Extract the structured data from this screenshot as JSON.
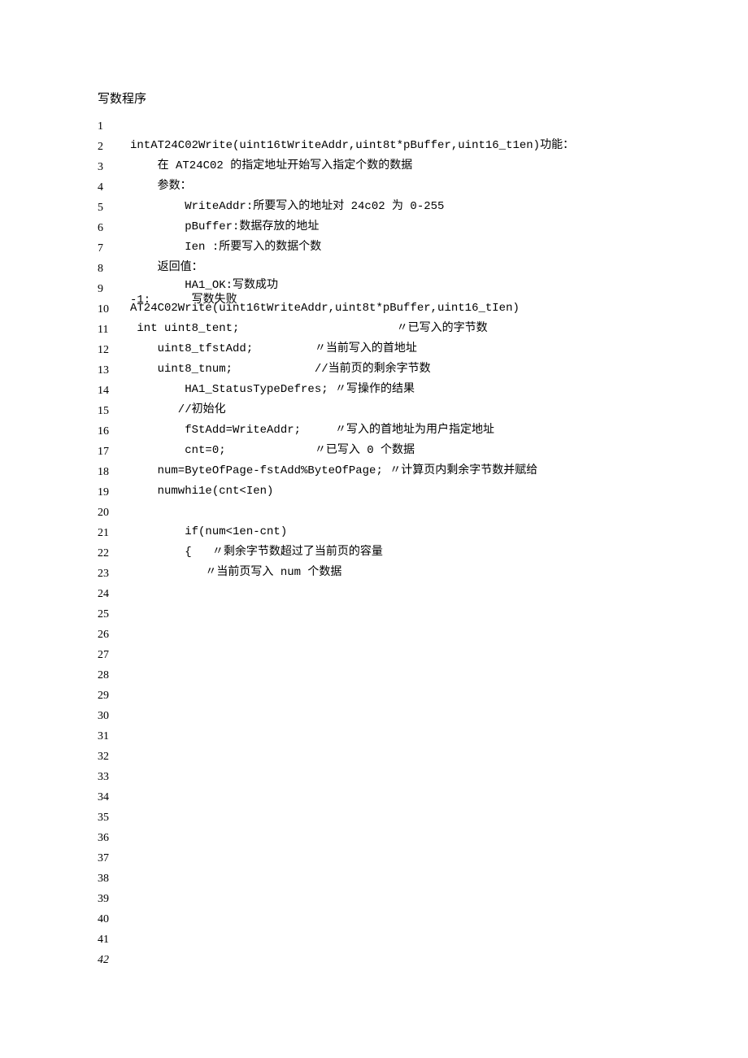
{
  "title": "写数程序",
  "lineNumbers": [
    "1",
    "2",
    "3",
    "4",
    "5",
    "6",
    "7",
    "8",
    "9",
    "10",
    "11",
    "12",
    "13",
    "14",
    "15",
    "16",
    "17",
    "18",
    "19",
    "20",
    "21",
    "22",
    "23",
    "24",
    "25",
    "26",
    "27",
    "28",
    "29",
    "30",
    "31",
    "32",
    "33",
    "34",
    "35",
    "36",
    "37",
    "38",
    "39",
    "40",
    "41",
    "42"
  ],
  "lastItalic": true,
  "code": {
    "l1": "",
    "l2": "intAT24C02Write(uint16tWriteAddr,uint8t*pBuffer,uint16_t1en)功能：",
    "l3": "    在 AT24C02 的指定地址开始写入指定个数的数据",
    "l4": "    参数：",
    "l5": "        WriteAddr:所要写入的地址对 24c02 为 0-255",
    "l6": "        pBuffer:数据存放的地址",
    "l7": "        Ien :所要写入的数据个数",
    "l8": "    返回值：",
    "l9": "        HA1_OK:写数成功",
    "l9b": "-1:      写数失败",
    "l10": "AT24C02Write(uint16tWriteAddr,uint8t*pBuffer,uint16_tIen)",
    "l11a": " int ",
    "l11b": "uint8_tent;                       〃已写入的字节数",
    "l12": "    uint8_tfstAdd;         〃当前写入的首地址",
    "l13": "    uint8_tnum;            //当前页的剩余字节数",
    "l14": "        HA1_StatusTypeDefres; 〃写操作的结果",
    "l15": "       //初始化",
    "l16": "        fStAdd=WriteAddr;     〃写入的首地址为用户指定地址",
    "l17": "        cnt=0;             〃已写入 0 个数据",
    "l18": "    num=ByteOfPage-fstAdd%ByteOfPage; 〃计算页内剩余字节数并赋给",
    "l19": "    numwhi1e(cnt<Ien)",
    "l20": "",
    "l21": "        if(num<1en-cnt)",
    "l22": "        {   〃剩余字节数超过了当前页的容量",
    "l23": "           〃当前页写入 num 个数据"
  }
}
